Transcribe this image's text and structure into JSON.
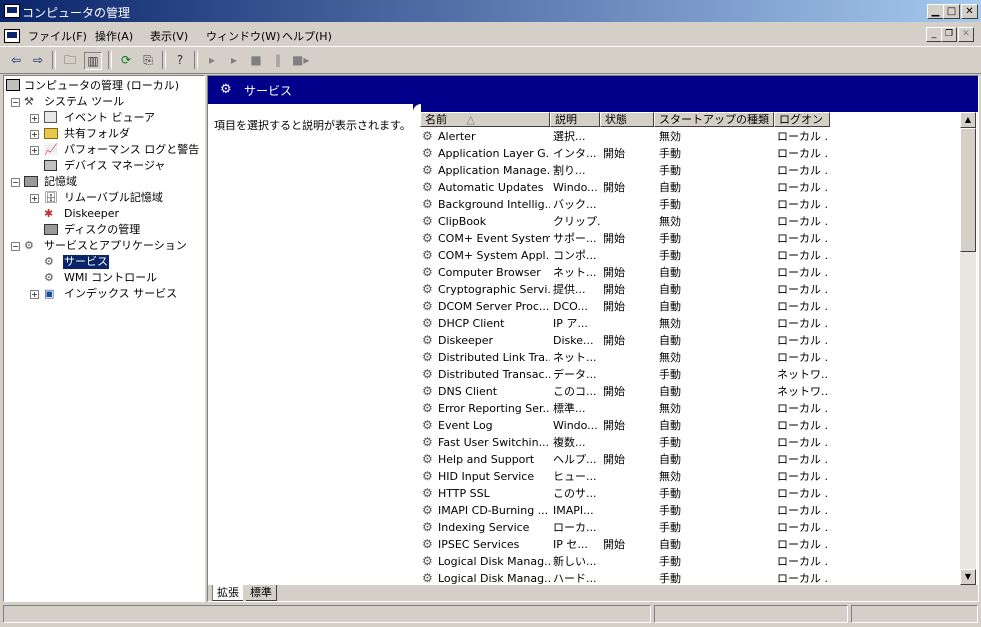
{
  "window": {
    "title": "コンピュータの管理"
  },
  "menu": [
    "ファイル(F)",
    "操作(A)",
    "表示(V)",
    "ウィンドウ(W)",
    "ヘルプ(H)"
  ],
  "tree": {
    "root": "コンピュータの管理 (ローカル)",
    "system_tools": "システム ツール",
    "event_viewer": "イベント ビューア",
    "shared_folders": "共有フォルダ",
    "perf_logs": "パフォーマンス ログと警告",
    "device_manager": "デバイス マネージャ",
    "storage": "記憶域",
    "removable": "リムーバブル記憶域",
    "diskeeper": "Diskeeper",
    "disk_mgmt": "ディスクの管理",
    "services_apps": "サービスとアプリケーション",
    "services": "サービス",
    "wmi": "WMI コントロール",
    "indexing": "インデックス サービス"
  },
  "right": {
    "header": "サービス",
    "description_hint": "項目を選択すると説明が表示されます。",
    "columns": [
      "名前",
      "説明",
      "状態",
      "スタートアップの種類",
      "ログオン"
    ],
    "sort_indicator": "△",
    "rows": [
      [
        "Alerter",
        "選択...",
        "",
        "無効",
        "ローカル ..."
      ],
      [
        "Application Layer G...",
        "インタ...",
        "開始",
        "手動",
        "ローカル ..."
      ],
      [
        "Application Manage...",
        "割り...",
        "",
        "手動",
        "ローカル ..."
      ],
      [
        "Automatic Updates",
        "Windo...",
        "開始",
        "自動",
        "ローカル ..."
      ],
      [
        "Background Intellig...",
        "バック...",
        "",
        "手動",
        "ローカル ..."
      ],
      [
        "ClipBook",
        "クリップ...",
        "",
        "無効",
        "ローカル ..."
      ],
      [
        "COM+ Event System",
        "サポー...",
        "開始",
        "手動",
        "ローカル ..."
      ],
      [
        "COM+ System Appl...",
        "コンポ...",
        "",
        "手動",
        "ローカル ..."
      ],
      [
        "Computer Browser",
        "ネット...",
        "開始",
        "自動",
        "ローカル ..."
      ],
      [
        "Cryptographic Servi...",
        "提供...",
        "開始",
        "自動",
        "ローカル ..."
      ],
      [
        "DCOM Server Proc...",
        "DCO...",
        "開始",
        "自動",
        "ローカル ..."
      ],
      [
        "DHCP Client",
        "IP ア...",
        "",
        "無効",
        "ローカル ..."
      ],
      [
        "Diskeeper",
        "Diske...",
        "開始",
        "自動",
        "ローカル ..."
      ],
      [
        "Distributed Link Tra...",
        "ネット...",
        "",
        "無効",
        "ローカル ..."
      ],
      [
        "Distributed Transac...",
        "データ...",
        "",
        "手動",
        "ネットワ..."
      ],
      [
        "DNS Client",
        "このコ...",
        "開始",
        "自動",
        "ネットワ..."
      ],
      [
        "Error Reporting Ser...",
        "標準...",
        "",
        "無効",
        "ローカル ..."
      ],
      [
        "Event Log",
        "Windo...",
        "開始",
        "自動",
        "ローカル ..."
      ],
      [
        "Fast User Switchin...",
        "複数...",
        "",
        "手動",
        "ローカル ..."
      ],
      [
        "Help and Support",
        "ヘルプ...",
        "開始",
        "自動",
        "ローカル ..."
      ],
      [
        "HID Input Service",
        "ヒュー...",
        "",
        "無効",
        "ローカル ..."
      ],
      [
        "HTTP SSL",
        "このサ...",
        "",
        "手動",
        "ローカル ..."
      ],
      [
        "IMAPI CD-Burning ...",
        "IMAPI...",
        "",
        "手動",
        "ローカル ..."
      ],
      [
        "Indexing Service",
        "ローカ...",
        "",
        "手動",
        "ローカル ..."
      ],
      [
        "IPSEC Services",
        "IP セ...",
        "開始",
        "自動",
        "ローカル ..."
      ],
      [
        "Logical Disk Manag...",
        "新しい...",
        "",
        "手動",
        "ローカル ..."
      ],
      [
        "Logical Disk Manag...",
        "ハード...",
        "",
        "手動",
        "ローカル ..."
      ]
    ]
  },
  "tabs": {
    "extended": "拡張",
    "standard": "標準"
  }
}
